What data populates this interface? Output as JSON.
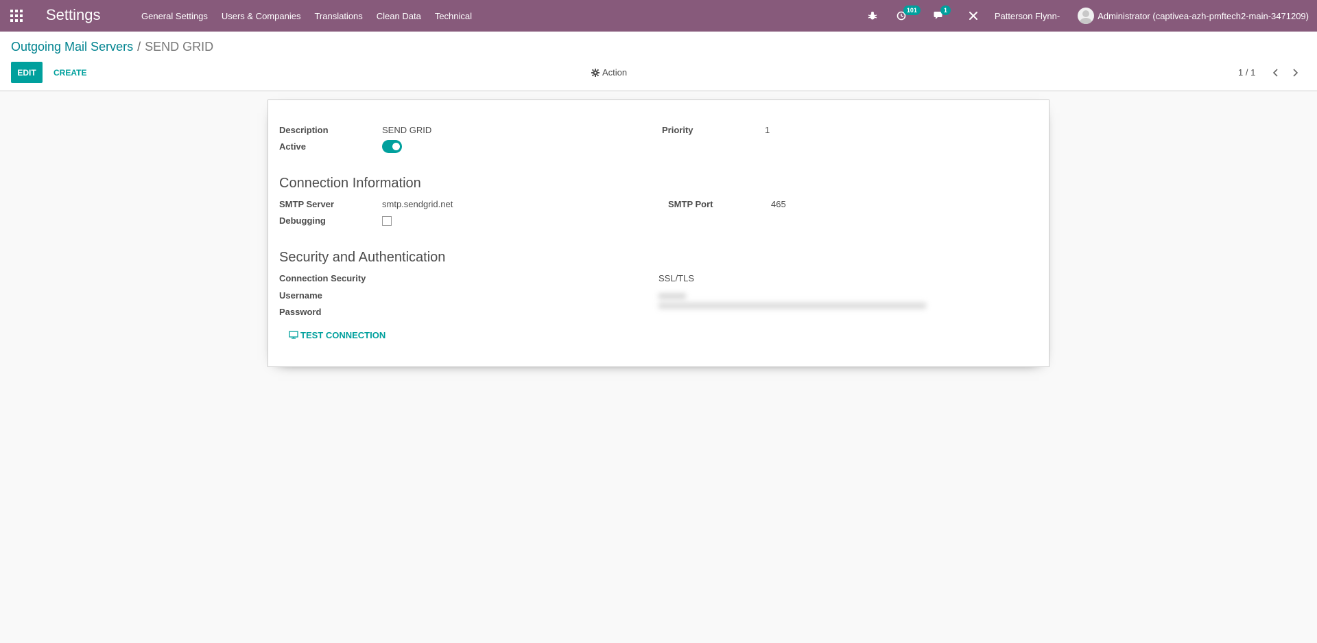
{
  "topbar": {
    "app_title": "Settings",
    "menu": [
      "General Settings",
      "Users & Companies",
      "Translations",
      "Clean Data",
      "Technical"
    ],
    "activity_count": "101",
    "messages_count": "1",
    "company": "Patterson Flynn-",
    "user": "Administrator (captivea-azh-pmftech2-main-3471209)",
    "colors": {
      "bar": "#875a7b",
      "badge": "#00a09d"
    },
    "icons": [
      "apps-grid-icon",
      "bug-icon",
      "clock-icon",
      "chat-icon",
      "tools-icon",
      "avatar"
    ]
  },
  "control_panel": {
    "breadcrumb_parent": "Outgoing Mail Servers",
    "breadcrumb_separator": "/",
    "breadcrumb_current": "SEND GRID",
    "edit_label": "EDIT",
    "create_label": "CREATE",
    "action_label": "Action",
    "pager": "1 / 1"
  },
  "form": {
    "description_label": "Description",
    "description_value": "SEND GRID",
    "active_label": "Active",
    "active_value": true,
    "priority_label": "Priority",
    "priority_value": "1",
    "connection_title": "Connection Information",
    "smtp_server_label": "SMTP Server",
    "smtp_server_value": "smtp.sendgrid.net",
    "smtp_port_label": "SMTP Port",
    "smtp_port_value": "465",
    "debugging_label": "Debugging",
    "debugging_value": false,
    "security_title": "Security and Authentication",
    "conn_security_label": "Connection Security",
    "conn_security_value": "SSL/TLS",
    "username_label": "Username",
    "password_label": "Password",
    "test_connection_label": "TEST CONNECTION"
  }
}
